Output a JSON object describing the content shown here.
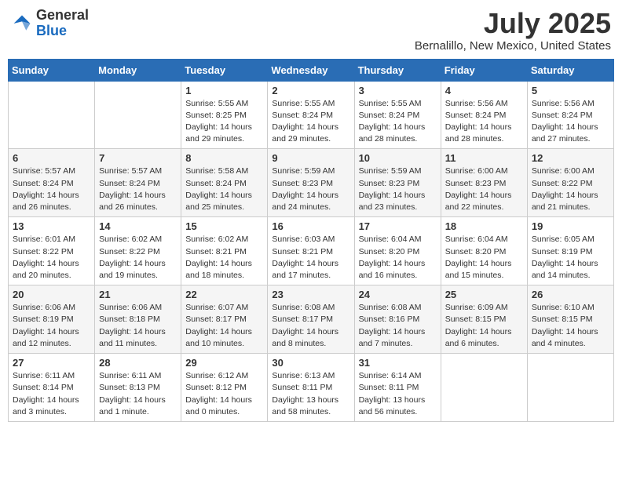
{
  "logo": {
    "general": "General",
    "blue": "Blue"
  },
  "title": "July 2025",
  "location": "Bernalillo, New Mexico, United States",
  "days_header": [
    "Sunday",
    "Monday",
    "Tuesday",
    "Wednesday",
    "Thursday",
    "Friday",
    "Saturday"
  ],
  "weeks": [
    [
      {
        "day": "",
        "info": ""
      },
      {
        "day": "",
        "info": ""
      },
      {
        "day": "1",
        "info": "Sunrise: 5:55 AM\nSunset: 8:25 PM\nDaylight: 14 hours and 29 minutes."
      },
      {
        "day": "2",
        "info": "Sunrise: 5:55 AM\nSunset: 8:24 PM\nDaylight: 14 hours and 29 minutes."
      },
      {
        "day": "3",
        "info": "Sunrise: 5:55 AM\nSunset: 8:24 PM\nDaylight: 14 hours and 28 minutes."
      },
      {
        "day": "4",
        "info": "Sunrise: 5:56 AM\nSunset: 8:24 PM\nDaylight: 14 hours and 28 minutes."
      },
      {
        "day": "5",
        "info": "Sunrise: 5:56 AM\nSunset: 8:24 PM\nDaylight: 14 hours and 27 minutes."
      }
    ],
    [
      {
        "day": "6",
        "info": "Sunrise: 5:57 AM\nSunset: 8:24 PM\nDaylight: 14 hours and 26 minutes."
      },
      {
        "day": "7",
        "info": "Sunrise: 5:57 AM\nSunset: 8:24 PM\nDaylight: 14 hours and 26 minutes."
      },
      {
        "day": "8",
        "info": "Sunrise: 5:58 AM\nSunset: 8:24 PM\nDaylight: 14 hours and 25 minutes."
      },
      {
        "day": "9",
        "info": "Sunrise: 5:59 AM\nSunset: 8:23 PM\nDaylight: 14 hours and 24 minutes."
      },
      {
        "day": "10",
        "info": "Sunrise: 5:59 AM\nSunset: 8:23 PM\nDaylight: 14 hours and 23 minutes."
      },
      {
        "day": "11",
        "info": "Sunrise: 6:00 AM\nSunset: 8:23 PM\nDaylight: 14 hours and 22 minutes."
      },
      {
        "day": "12",
        "info": "Sunrise: 6:00 AM\nSunset: 8:22 PM\nDaylight: 14 hours and 21 minutes."
      }
    ],
    [
      {
        "day": "13",
        "info": "Sunrise: 6:01 AM\nSunset: 8:22 PM\nDaylight: 14 hours and 20 minutes."
      },
      {
        "day": "14",
        "info": "Sunrise: 6:02 AM\nSunset: 8:22 PM\nDaylight: 14 hours and 19 minutes."
      },
      {
        "day": "15",
        "info": "Sunrise: 6:02 AM\nSunset: 8:21 PM\nDaylight: 14 hours and 18 minutes."
      },
      {
        "day": "16",
        "info": "Sunrise: 6:03 AM\nSunset: 8:21 PM\nDaylight: 14 hours and 17 minutes."
      },
      {
        "day": "17",
        "info": "Sunrise: 6:04 AM\nSunset: 8:20 PM\nDaylight: 14 hours and 16 minutes."
      },
      {
        "day": "18",
        "info": "Sunrise: 6:04 AM\nSunset: 8:20 PM\nDaylight: 14 hours and 15 minutes."
      },
      {
        "day": "19",
        "info": "Sunrise: 6:05 AM\nSunset: 8:19 PM\nDaylight: 14 hours and 14 minutes."
      }
    ],
    [
      {
        "day": "20",
        "info": "Sunrise: 6:06 AM\nSunset: 8:19 PM\nDaylight: 14 hours and 12 minutes."
      },
      {
        "day": "21",
        "info": "Sunrise: 6:06 AM\nSunset: 8:18 PM\nDaylight: 14 hours and 11 minutes."
      },
      {
        "day": "22",
        "info": "Sunrise: 6:07 AM\nSunset: 8:17 PM\nDaylight: 14 hours and 10 minutes."
      },
      {
        "day": "23",
        "info": "Sunrise: 6:08 AM\nSunset: 8:17 PM\nDaylight: 14 hours and 8 minutes."
      },
      {
        "day": "24",
        "info": "Sunrise: 6:08 AM\nSunset: 8:16 PM\nDaylight: 14 hours and 7 minutes."
      },
      {
        "day": "25",
        "info": "Sunrise: 6:09 AM\nSunset: 8:15 PM\nDaylight: 14 hours and 6 minutes."
      },
      {
        "day": "26",
        "info": "Sunrise: 6:10 AM\nSunset: 8:15 PM\nDaylight: 14 hours and 4 minutes."
      }
    ],
    [
      {
        "day": "27",
        "info": "Sunrise: 6:11 AM\nSunset: 8:14 PM\nDaylight: 14 hours and 3 minutes."
      },
      {
        "day": "28",
        "info": "Sunrise: 6:11 AM\nSunset: 8:13 PM\nDaylight: 14 hours and 1 minute."
      },
      {
        "day": "29",
        "info": "Sunrise: 6:12 AM\nSunset: 8:12 PM\nDaylight: 14 hours and 0 minutes."
      },
      {
        "day": "30",
        "info": "Sunrise: 6:13 AM\nSunset: 8:11 PM\nDaylight: 13 hours and 58 minutes."
      },
      {
        "day": "31",
        "info": "Sunrise: 6:14 AM\nSunset: 8:11 PM\nDaylight: 13 hours and 56 minutes."
      },
      {
        "day": "",
        "info": ""
      },
      {
        "day": "",
        "info": ""
      }
    ]
  ]
}
